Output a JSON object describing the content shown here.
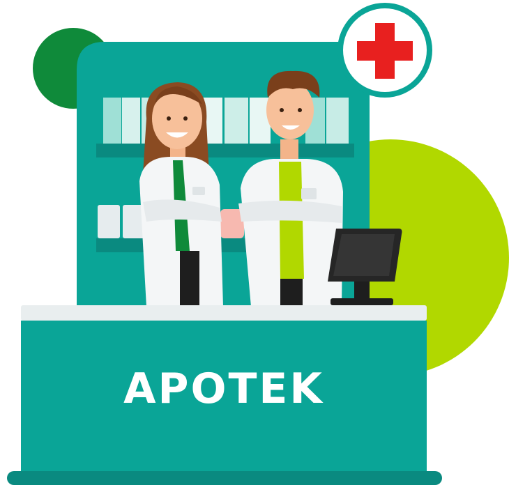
{
  "sign": {
    "label": "APOTEK"
  },
  "colors": {
    "teal": "#0aa597",
    "teal_dark": "#0a8a80",
    "green_dark": "#0f8a3a",
    "lime": "#b1d800",
    "red_cross": "#e8201f",
    "coat": "#f4f6f7"
  },
  "icons": {
    "cross": "medical-cross-icon"
  }
}
